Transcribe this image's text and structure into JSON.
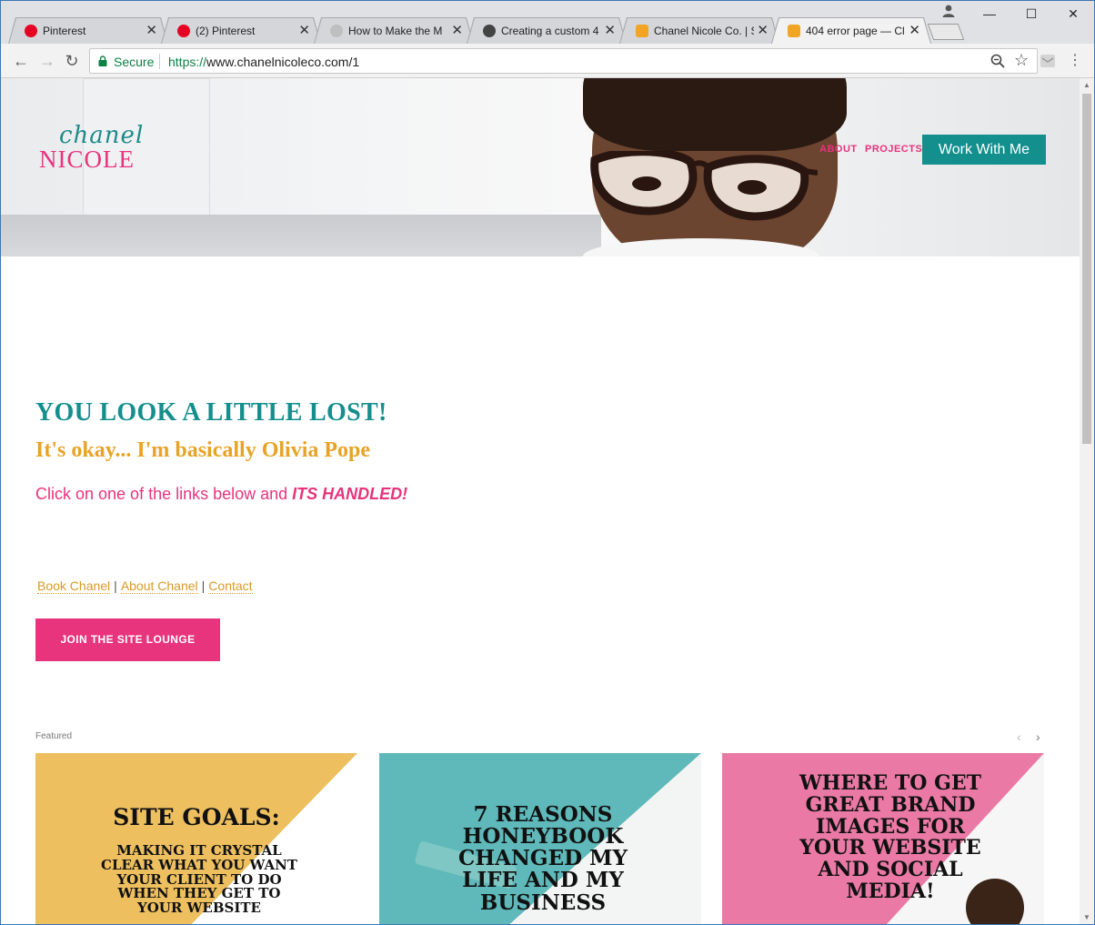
{
  "browser": {
    "tabs": [
      {
        "title": "Pinterest",
        "favicon_color": "#e60023",
        "active": false
      },
      {
        "title": "(2) Pinterest",
        "favicon_color": "#e60023",
        "active": false
      },
      {
        "title": "How to Make the M",
        "favicon_color": "#bfbfbf",
        "active": false
      },
      {
        "title": "Creating a custom 4",
        "favicon_color": "#444444",
        "active": false
      },
      {
        "title": "Chanel Nicole Co. | S",
        "favicon_color": "#f2a522",
        "active": false
      },
      {
        "title": "404 error page — Cl",
        "favicon_color": "#f2a522",
        "active": true
      }
    ],
    "tab_close_glyph": "✕",
    "window_controls": {
      "minimize": "—",
      "maximize": "☐",
      "close": "✕"
    },
    "secure_label": "Secure",
    "url_protocol": "https://",
    "url_rest": "www.chanelnicoleco.com/1"
  },
  "site": {
    "logo_script": "chanel",
    "logo_caps": "NICOLE",
    "nav": {
      "about": "ABOUT",
      "projects": "PROJECTS",
      "cta": "Work With Me"
    },
    "heading": "YOU LOOK A LITTLE LOST!",
    "subheading": "It's okay... I'm basically Olivia Pope",
    "click_prefix": "Click on one of the links below and ",
    "click_emphasis": "ITS HANDLED!",
    "links": [
      "Book Chanel",
      "About Chanel",
      "Contact"
    ],
    "join_button": "JOIN THE SITE LOUNGE",
    "featured_label": "Featured",
    "cards": [
      {
        "title": "SITE GOALS:",
        "subtitle": "MAKING IT CRYSTAL CLEAR WHAT YOU WANT YOUR CLIENT TO DO WHEN THEY GET TO YOUR WEBSITE",
        "color": "#edbf5f"
      },
      {
        "title": "7 REASONS HONEYBOOK CHANGED MY LIFE AND MY BUSINESS",
        "subtitle": "",
        "color": "#5fb8b9"
      },
      {
        "title": "WHERE TO GET GREAT BRAND IMAGES FOR YOUR WEBSITE AND SOCIAL MEDIA!",
        "subtitle": "",
        "color": "#ea7aa5"
      }
    ]
  },
  "colors": {
    "teal": "#148f8d",
    "gold": "#e8a326",
    "pink": "#e8337d"
  }
}
